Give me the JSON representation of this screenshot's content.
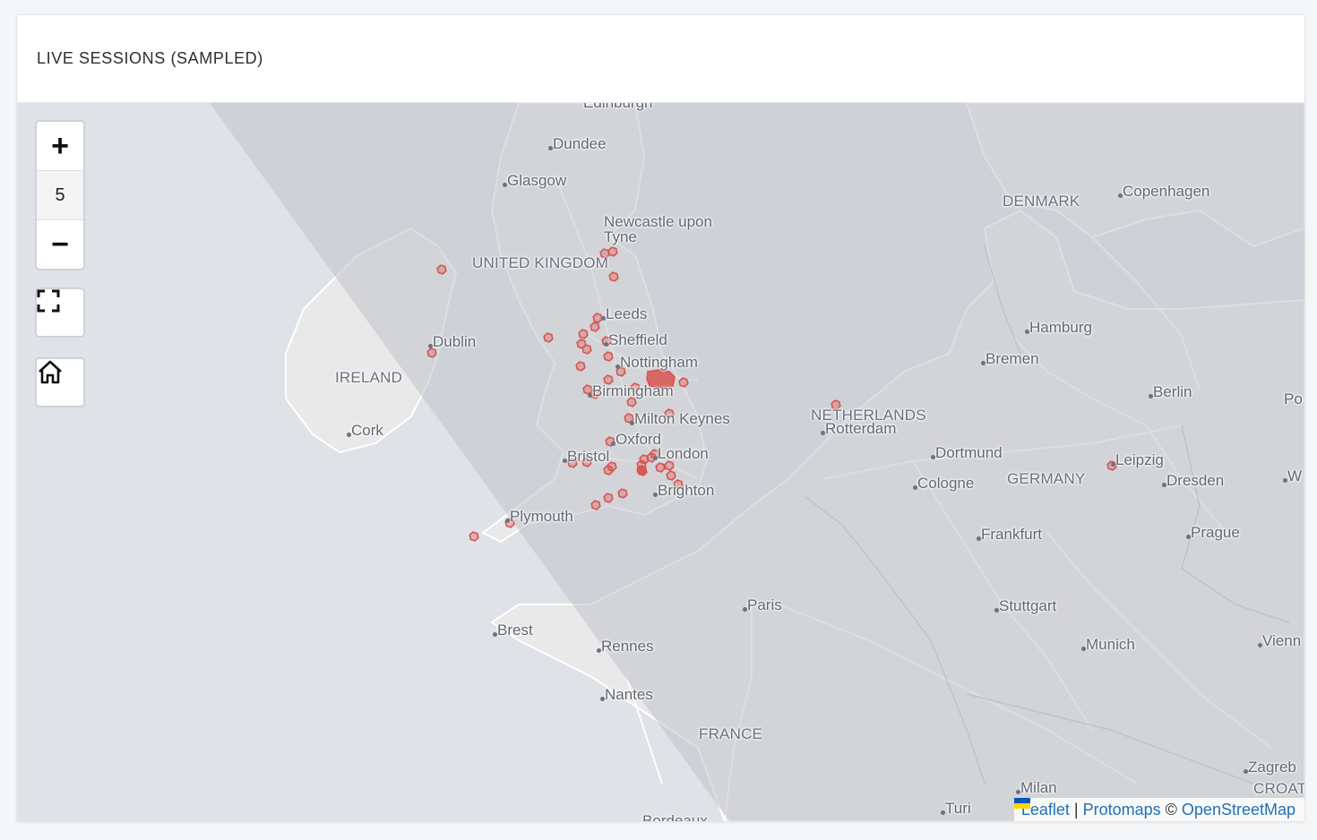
{
  "card": {
    "title": "LIVE SESSIONS (SAMPLED)"
  },
  "zoom": {
    "in_label": "+",
    "level": "5",
    "out_label": "−"
  },
  "map": {
    "places": [
      {
        "key": "dundee",
        "label": "Dundee"
      },
      {
        "key": "glasgow",
        "label": "Glasgow"
      },
      {
        "key": "newcastle1",
        "label": "Newcastle upon"
      },
      {
        "key": "newcastle2",
        "label": "Tyne"
      },
      {
        "key": "uk",
        "label": "UNITED KINGDOM"
      },
      {
        "key": "leeds",
        "label": "Leeds"
      },
      {
        "key": "sheffield",
        "label": "Sheffield"
      },
      {
        "key": "nottingham",
        "label": "Nottingham"
      },
      {
        "key": "birmingham",
        "label": "Birmingham"
      },
      {
        "key": "milton",
        "label": "Milton Keynes"
      },
      {
        "key": "oxford",
        "label": "Oxford"
      },
      {
        "key": "bristol",
        "label": "Bristol"
      },
      {
        "key": "london",
        "label": "London"
      },
      {
        "key": "brighton",
        "label": "Brighton"
      },
      {
        "key": "plymouth",
        "label": "Plymouth"
      },
      {
        "key": "dublin",
        "label": "Dublin"
      },
      {
        "key": "ireland",
        "label": "IRELAND"
      },
      {
        "key": "cork",
        "label": "Cork"
      },
      {
        "key": "denmark",
        "label": "DENMARK"
      },
      {
        "key": "copenhagen",
        "label": "Copenhagen"
      },
      {
        "key": "hamburg",
        "label": "Hamburg"
      },
      {
        "key": "bremen",
        "label": "Bremen"
      },
      {
        "key": "berlin",
        "label": "Berlin"
      },
      {
        "key": "po",
        "label": "Po"
      },
      {
        "key": "netherlands",
        "label": "NETHERLANDS"
      },
      {
        "key": "rotterdam",
        "label": "Rotterdam"
      },
      {
        "key": "dortmund",
        "label": "Dortmund"
      },
      {
        "key": "cologne",
        "label": "Cologne"
      },
      {
        "key": "germany",
        "label": "GERMANY"
      },
      {
        "key": "leipzig",
        "label": "Leipzig"
      },
      {
        "key": "dresden",
        "label": "Dresden"
      },
      {
        "key": "w",
        "label": "W"
      },
      {
        "key": "frankfurt",
        "label": "Frankfurt"
      },
      {
        "key": "prague",
        "label": "Prague"
      },
      {
        "key": "paris",
        "label": "Paris"
      },
      {
        "key": "stuttgart",
        "label": "Stuttgart"
      },
      {
        "key": "munich",
        "label": "Munich"
      },
      {
        "key": "vienna",
        "label": "Vienn"
      },
      {
        "key": "brest",
        "label": "Brest"
      },
      {
        "key": "rennes",
        "label": "Rennes"
      },
      {
        "key": "nantes",
        "label": "Nantes"
      },
      {
        "key": "france",
        "label": "FRANCE"
      },
      {
        "key": "zagreb",
        "label": "Zagreb"
      },
      {
        "key": "croat",
        "label": "CROAT"
      },
      {
        "key": "milan",
        "label": "Milan"
      },
      {
        "key": "turin",
        "label": "Turi"
      },
      {
        "key": "bordeaux",
        "label": "Bordeaux"
      },
      {
        "key": "top",
        "label": "Edinburgh"
      }
    ]
  },
  "attribution": {
    "leaflet": "Leaflet",
    "separator": "|",
    "protomaps": "Protomaps",
    "copyright": "©",
    "osm": "OpenStreetMap"
  },
  "colors": {
    "session_marker": "#d9534f",
    "night_overlay": "#c3c7cc",
    "land": "#e9e9e9",
    "sea": "#dfe3e8"
  }
}
